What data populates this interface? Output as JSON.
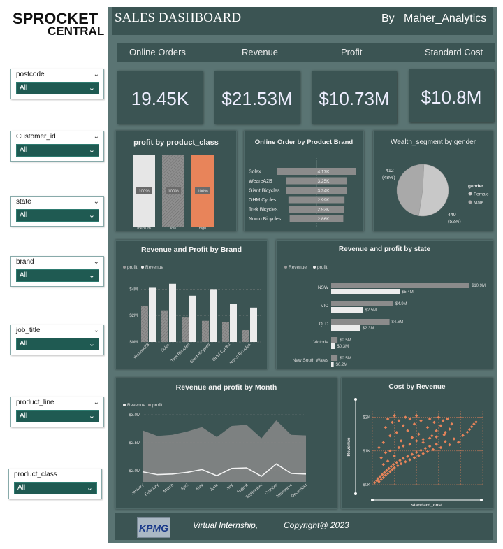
{
  "logo": {
    "line1": "SPROCKET",
    "line2": "CENTRAL"
  },
  "header": {
    "title": "SALES DASHBOARD",
    "by": "By",
    "author": "Maher_Analytics"
  },
  "kpi_headers": [
    "Online Orders",
    "Revenue",
    "Profit",
    "Standard Cost"
  ],
  "kpis": [
    "19.45K",
    "$21.53M",
    "$10.73M",
    "$10.8M"
  ],
  "slicers": [
    {
      "label": "postcode",
      "value": "All"
    },
    {
      "label": "Customer_id",
      "value": "All"
    },
    {
      "label": "state",
      "value": "All"
    },
    {
      "label": "brand",
      "value": "All"
    },
    {
      "label": "job_title",
      "value": "All"
    },
    {
      "label": "product_line",
      "value": "All"
    },
    {
      "label": "product_class",
      "value": "All"
    }
  ],
  "footer": {
    "internship": "Virtual Internship,",
    "copyright": "Copyright@ 2023",
    "logo": "KPMG"
  },
  "colors": {
    "panel": "#3b5453",
    "bg": "#5a7473",
    "accent": "#e8845a",
    "dropdown": "#1f5a52"
  },
  "chart_data": [
    {
      "type": "bar",
      "title": "profit by product_class",
      "categories": [
        "medium",
        "low",
        "high"
      ],
      "values": [
        100,
        100,
        100
      ],
      "data_labels": [
        "100%",
        "100%",
        "100%"
      ]
    },
    {
      "type": "bar",
      "title": "Online Order by Product Brand",
      "categories": [
        "Solex",
        "WeareA2B",
        "Giant Bicycles",
        "OHM Cycles",
        "Trek Bicycles",
        "Norco Bicycles"
      ],
      "values": [
        4170,
        3250,
        3240,
        2990,
        2930,
        2860
      ],
      "data_labels": [
        "4.17K",
        "3.25K",
        "3.24K",
        "2.99K",
        "2.93K",
        "2.86K"
      ]
    },
    {
      "type": "pie",
      "title": "Wealth_segment by gender",
      "legend_title": "gender",
      "series": [
        {
          "name": "Female",
          "value": 440,
          "label": "440",
          "pct": "(52%)"
        },
        {
          "name": "Male",
          "value": 412,
          "label": "412",
          "pct": "(48%)"
        }
      ]
    },
    {
      "type": "bar",
      "title": "Revenue and Profit by Brand",
      "categories": [
        "WeareA2B",
        "Solex",
        "Trek Bicycles",
        "Giant Bicycles",
        "OHM Cycles",
        "Norco Bicycles"
      ],
      "series": [
        {
          "name": "profit",
          "values": [
            2.7,
            2.4,
            1.9,
            1.6,
            1.5,
            0.9
          ]
        },
        {
          "name": "Revenue",
          "values": [
            4.1,
            4.4,
            3.5,
            4.0,
            2.9,
            2.6
          ]
        }
      ],
      "y_ticks": [
        "$0M",
        "$2M",
        "$4M"
      ],
      "ylim": [
        0,
        4.6
      ]
    },
    {
      "type": "bar",
      "title": "Revenue and profit by state",
      "categories": [
        "NSW",
        "VIC",
        "QLD",
        "Victoria",
        "New South Wales"
      ],
      "series": [
        {
          "name": "Revenue",
          "values": [
            10.9,
            4.9,
            4.6,
            0.5,
            0.5
          ],
          "labels": [
            "$10.9M",
            "$4.9M",
            "$4.6M",
            "$0.5M",
            "$0.5M"
          ]
        },
        {
          "name": "profit",
          "values": [
            5.4,
            2.5,
            2.3,
            0.3,
            0.2
          ],
          "labels": [
            "$5.4M",
            "$2.5M",
            "$2.3M",
            "$0.3M",
            "$0.2M"
          ]
        }
      ]
    },
    {
      "type": "area",
      "title": "Revenue and profit by Month",
      "categories": [
        "January",
        "February",
        "March",
        "April",
        "May",
        "June",
        "July",
        "August",
        "September",
        "October",
        "November",
        "December"
      ],
      "series": [
        {
          "name": "Revenue",
          "values": [
            2.72,
            2.62,
            2.64,
            2.7,
            2.78,
            2.6,
            2.8,
            2.82,
            2.58,
            2.9,
            2.64,
            2.63
          ]
        },
        {
          "name": "profit",
          "values": [
            1.98,
            1.93,
            1.94,
            1.97,
            2.02,
            1.91,
            2.04,
            2.05,
            1.9,
            2.12,
            1.95,
            1.94
          ]
        }
      ],
      "y_ticks": [
        "$2.0M",
        "$2.5M",
        "$3.0M"
      ],
      "ylim": [
        1.8,
        3.0
      ]
    },
    {
      "type": "scatter",
      "title": "Cost by Revenue",
      "xlabel": "standard_cost",
      "ylabel": "Revenue",
      "y_ticks": [
        "$0K",
        "$1K",
        "$2K"
      ],
      "ylim": [
        0,
        2200
      ],
      "xlim": [
        0,
        1
      ],
      "points": [
        [
          0.02,
          60
        ],
        [
          0.04,
          120
        ],
        [
          0.05,
          180
        ],
        [
          0.06,
          90
        ],
        [
          0.07,
          240
        ],
        [
          0.08,
          150
        ],
        [
          0.09,
          300
        ],
        [
          0.1,
          210
        ],
        [
          0.11,
          360
        ],
        [
          0.12,
          280
        ],
        [
          0.13,
          420
        ],
        [
          0.14,
          330
        ],
        [
          0.15,
          480
        ],
        [
          0.16,
          390
        ],
        [
          0.17,
          540
        ],
        [
          0.18,
          450
        ],
        [
          0.19,
          600
        ],
        [
          0.2,
          500
        ],
        [
          0.22,
          660
        ],
        [
          0.23,
          560
        ],
        [
          0.25,
          720
        ],
        [
          0.26,
          620
        ],
        [
          0.28,
          780
        ],
        [
          0.3,
          680
        ],
        [
          0.32,
          840
        ],
        [
          0.34,
          740
        ],
        [
          0.36,
          900
        ],
        [
          0.38,
          800
        ],
        [
          0.4,
          960
        ],
        [
          0.42,
          860
        ],
        [
          0.44,
          1020
        ],
        [
          0.46,
          920
        ],
        [
          0.48,
          1080
        ],
        [
          0.5,
          980
        ],
        [
          0.52,
          1140
        ],
        [
          0.55,
          1040
        ],
        [
          0.58,
          1200
        ],
        [
          0.62,
          1100
        ],
        [
          0.66,
          1280
        ],
        [
          0.7,
          1180
        ],
        [
          0.74,
          1360
        ],
        [
          0.78,
          1260
        ],
        [
          0.82,
          1460
        ],
        [
          0.86,
          1560
        ],
        [
          0.88,
          1640
        ],
        [
          0.9,
          1720
        ],
        [
          0.92,
          1800
        ],
        [
          0.94,
          1860
        ],
        [
          0.1,
          1250
        ],
        [
          0.12,
          1700
        ],
        [
          0.14,
          1950
        ],
        [
          0.16,
          1450
        ],
        [
          0.18,
          1850
        ],
        [
          0.2,
          2050
        ],
        [
          0.22,
          1550
        ],
        [
          0.24,
          1900
        ],
        [
          0.26,
          1300
        ],
        [
          0.28,
          1750
        ],
        [
          0.3,
          2000
        ],
        [
          0.32,
          1600
        ],
        [
          0.34,
          1950
        ],
        [
          0.36,
          1400
        ],
        [
          0.38,
          1800
        ],
        [
          0.4,
          2050
        ],
        [
          0.42,
          1500
        ],
        [
          0.44,
          1900
        ],
        [
          0.46,
          1350
        ],
        [
          0.5,
          1700
        ],
        [
          0.52,
          1950
        ],
        [
          0.54,
          1450
        ],
        [
          0.56,
          1850
        ],
        [
          0.58,
          1600
        ],
        [
          0.6,
          2000
        ],
        [
          0.62,
          1750
        ],
        [
          0.64,
          1900
        ],
        [
          0.66,
          1550
        ],
        [
          0.68,
          1950
        ],
        [
          0.7,
          1650
        ],
        [
          0.72,
          1800
        ],
        [
          0.06,
          1100
        ],
        [
          0.08,
          800
        ],
        [
          0.1,
          600
        ],
        [
          0.12,
          950
        ],
        [
          0.14,
          700
        ],
        [
          0.16,
          1000
        ],
        [
          0.2,
          850
        ],
        [
          0.24,
          1100
        ],
        [
          0.28,
          1150
        ],
        [
          0.34,
          1200
        ],
        [
          0.4,
          1300
        ],
        [
          0.46,
          1250
        ],
        [
          0.52,
          1380
        ],
        [
          0.58,
          1420
        ],
        [
          0.65,
          1480
        ]
      ]
    }
  ]
}
